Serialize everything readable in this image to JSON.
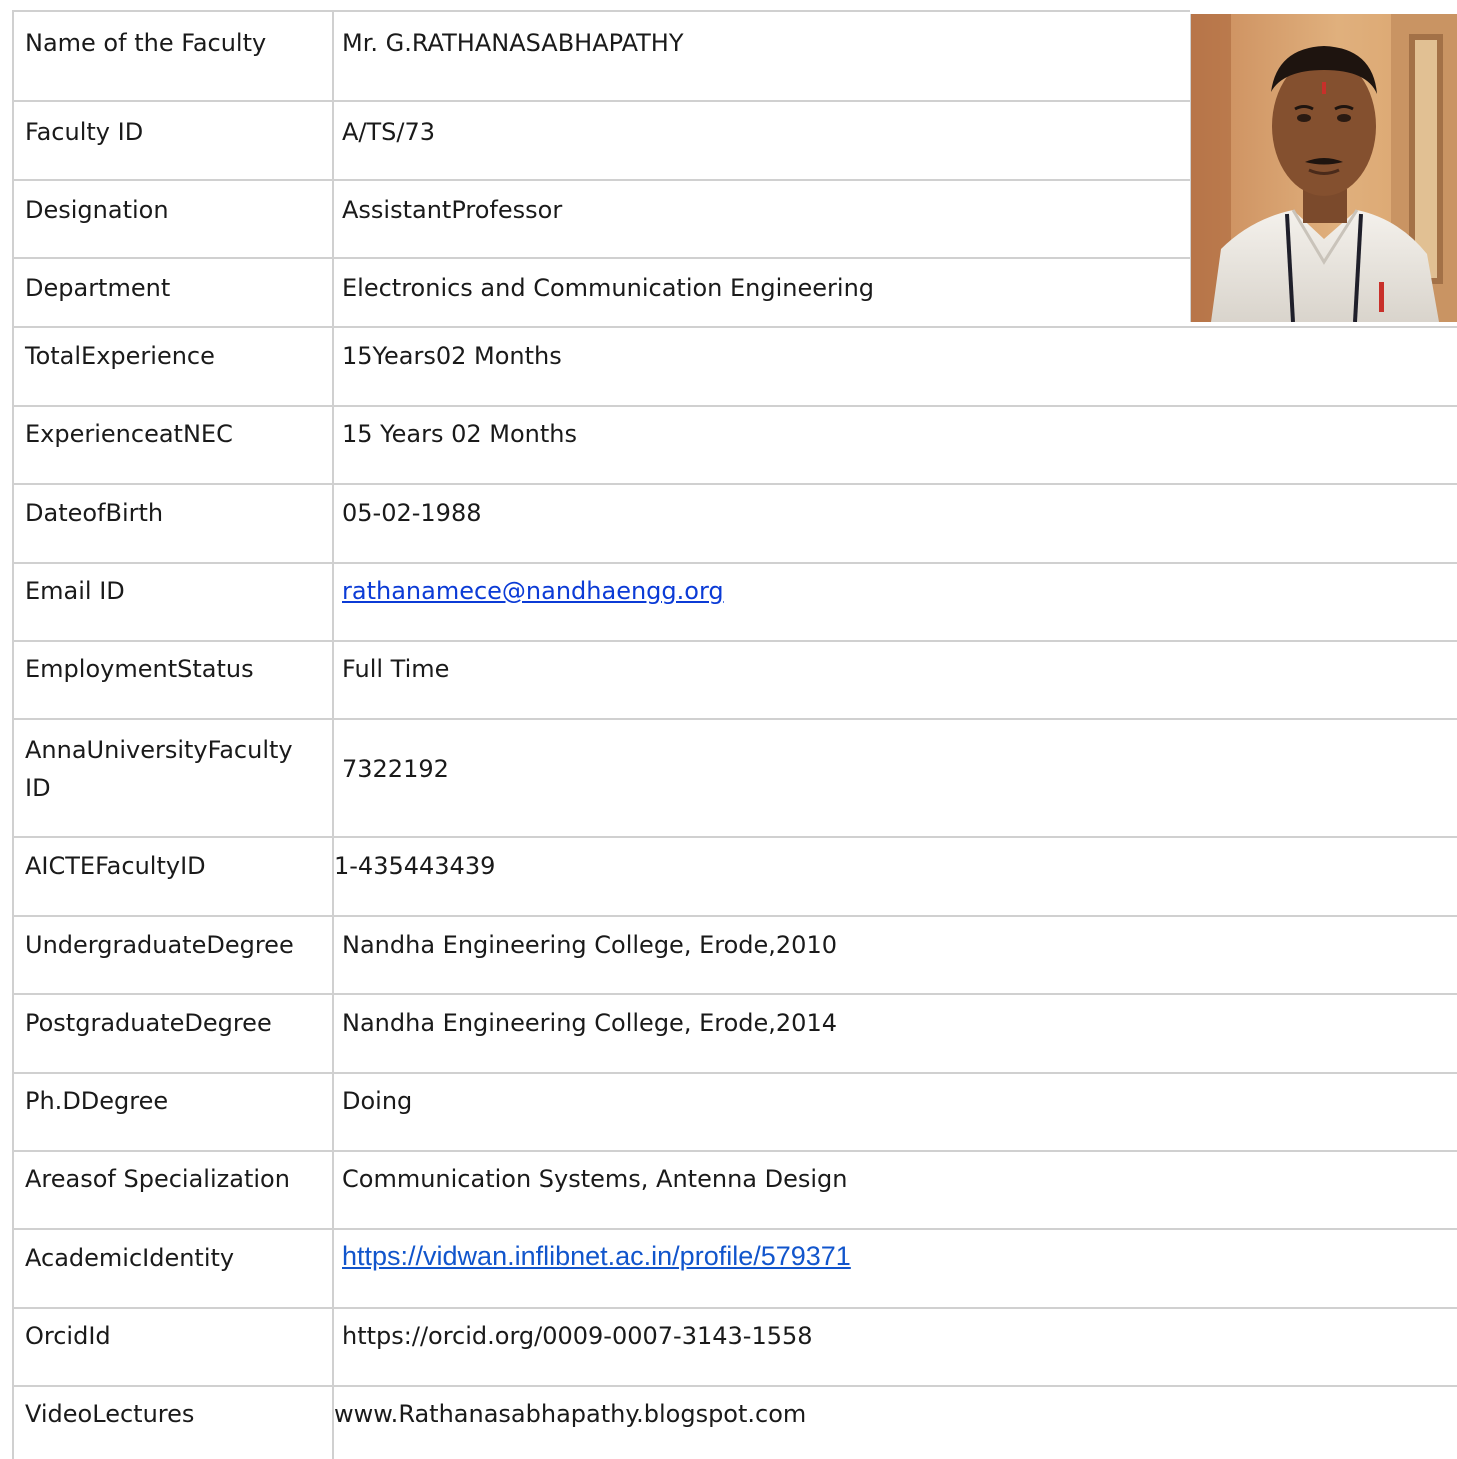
{
  "profile": {
    "rows": [
      {
        "label": "Name of the Faculty",
        "value": "Mr. G.RATHANASABHAPATHY"
      },
      {
        "label": "Faculty ID",
        "value": "A/TS/73"
      },
      {
        "label": "Designation",
        "value": "AssistantProfessor"
      },
      {
        "label": "Department",
        "value": "Electronics and Communication  Engineering"
      },
      {
        "label": "TotalExperience",
        "value": "15Years02 Months"
      },
      {
        "label": "ExperienceatNEC",
        "value": "15 Years 02 Months"
      },
      {
        "label": "DateofBirth",
        "value": "05-02-1988"
      },
      {
        "label": "Email ID",
        "value": "rathanamece@nandhaengg.org"
      },
      {
        "label": "EmploymentStatus",
        "value": "Full Time"
      },
      {
        "label": "AnnaUniversityFaculty ID",
        "value": "7322192"
      },
      {
        "label": "AICTEFacultyID",
        "value": "1-435443439"
      },
      {
        "label": "UndergraduateDegree",
        "value": "Nandha Engineering College, Erode,2010"
      },
      {
        "label": "PostgraduateDegree",
        "value": "Nandha Engineering College, Erode,2014"
      },
      {
        "label": "Ph.DDegree",
        "value": "Doing"
      },
      {
        "label": "Areasof Specialization",
        "value": "Communication Systems, Antenna Design"
      },
      {
        "label": "AcademicIdentity",
        "value": "https://vidwan.inflibnet.ac.in/profile/579371"
      },
      {
        "label": "OrcidId",
        "value": "https://orcid.org/0009-0007-3143-1558"
      },
      {
        "label": "VideoLectures",
        "value": "www.Rathanasabhapathy.blogspot.com"
      }
    ]
  },
  "colors": {
    "link": "#0b3bd6",
    "link_alt": "#1155cc",
    "grid": "#d0d0d0"
  }
}
